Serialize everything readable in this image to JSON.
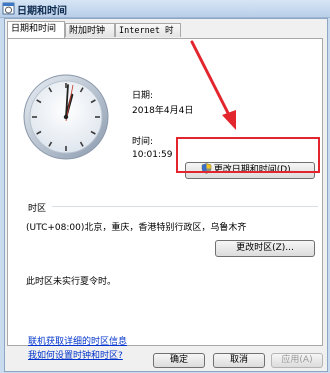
{
  "window": {
    "title": "日期和时间"
  },
  "tabs": [
    {
      "label": "日期和时间"
    },
    {
      "label": "附加时钟"
    },
    {
      "label": "Internet 时间"
    }
  ],
  "datetime": {
    "date_label": "日期:",
    "date_value": "2018年4月4日",
    "time_label": "时间:",
    "time_value": "10:01:59",
    "change_button": "更改日期和时间(D)..."
  },
  "timezone": {
    "section_label": "时区",
    "value": "(UTC+08:00)北京，重庆，香港特别行政区，乌鲁木齐",
    "change_button": "更改时区(Z)...",
    "dst_note": "此时区未实行夏令时。"
  },
  "links": {
    "online_info": "联机获取详细的时区信息",
    "how_to": "我如何设置时钟和时区?"
  },
  "footer": {
    "ok": "确定",
    "cancel": "取消",
    "apply": "应用(A)"
  },
  "icons": {
    "title": "clock-calendar-icon",
    "change_button": "uac-shield-icon"
  },
  "colors": {
    "annotation": "#e3262e",
    "link": "#0033cc"
  }
}
